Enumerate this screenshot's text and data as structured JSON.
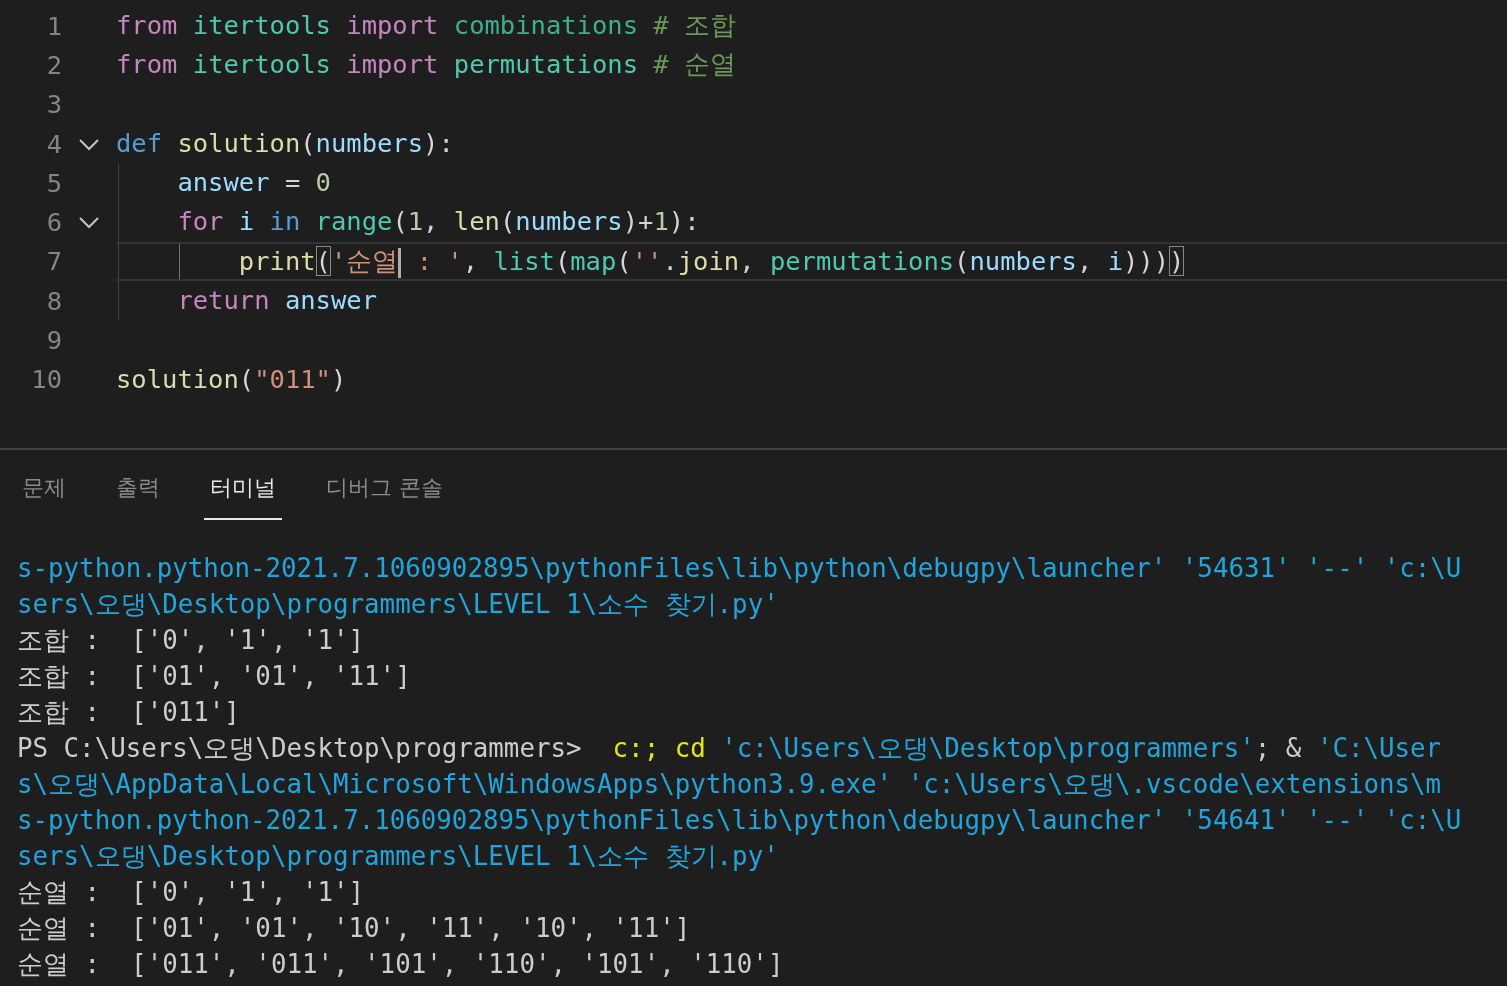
{
  "editor": {
    "lines": [
      {
        "number": "1",
        "current": false,
        "tokens": [
          {
            "text": "from",
            "kind": "keyword"
          },
          {
            "text": " itertools",
            "kind": "module"
          },
          {
            "text": " import",
            "kind": "keyword"
          },
          {
            "text": " combinations",
            "kind": "module_dim"
          },
          {
            "text": " # 조합",
            "kind": "comment"
          }
        ]
      },
      {
        "number": "2",
        "current": false,
        "tokens": [
          {
            "text": "from",
            "kind": "keyword"
          },
          {
            "text": " itertools",
            "kind": "module"
          },
          {
            "text": " import",
            "kind": "keyword"
          },
          {
            "text": " permutations",
            "kind": "module"
          },
          {
            "text": " # 순열",
            "kind": "comment"
          }
        ]
      },
      {
        "number": "3",
        "current": false
      },
      {
        "number": "4",
        "current": false,
        "expanded": true,
        "tokens": [
          {
            "text": "def",
            "kind": "storage"
          },
          {
            "text": " solution",
            "kind": "function"
          },
          {
            "text": "(",
            "kind": "plain"
          },
          {
            "text": "numbers",
            "kind": "variable"
          },
          {
            "text": "):",
            "kind": "plain"
          }
        ]
      },
      {
        "number": "5",
        "current": false,
        "tokens": [
          {
            "text": "    answer",
            "kind": "variable"
          },
          {
            "text": " = ",
            "kind": "plain"
          },
          {
            "text": "0",
            "kind": "number"
          }
        ]
      },
      {
        "number": "6",
        "current": false,
        "expanded": true,
        "tokens": [
          {
            "text": "    for",
            "kind": "keyword"
          },
          {
            "text": " i",
            "kind": "variable"
          },
          {
            "text": " in",
            "kind": "storage"
          },
          {
            "text": " range",
            "kind": "module"
          },
          {
            "text": "(",
            "kind": "plain"
          },
          {
            "text": "1",
            "kind": "number"
          },
          {
            "text": ", ",
            "kind": "plain"
          },
          {
            "text": "len",
            "kind": "function"
          },
          {
            "text": "(",
            "kind": "plain"
          },
          {
            "text": "numbers",
            "kind": "variable"
          },
          {
            "text": ")+",
            "kind": "plain"
          },
          {
            "text": "1",
            "kind": "number"
          },
          {
            "text": "):",
            "kind": "plain"
          }
        ]
      },
      {
        "number": "7",
        "current": true,
        "tokens": [
          {
            "text": "        print",
            "kind": "function"
          },
          {
            "text": "(",
            "kind": "plain",
            "matched": true
          },
          {
            "text": "'순열",
            "kind": "string",
            "cursor": true
          },
          {
            "text": " : '",
            "kind": "string"
          },
          {
            "text": ", ",
            "kind": "plain"
          },
          {
            "text": "list",
            "kind": "module"
          },
          {
            "text": "(",
            "kind": "plain"
          },
          {
            "text": "map",
            "kind": "module"
          },
          {
            "text": "(",
            "kind": "plain"
          },
          {
            "text": "''",
            "kind": "string"
          },
          {
            "text": ".",
            "kind": "plain"
          },
          {
            "text": "join",
            "kind": "function"
          },
          {
            "text": ", ",
            "kind": "plain"
          },
          {
            "text": "permutations",
            "kind": "module"
          },
          {
            "text": "(",
            "kind": "plain"
          },
          {
            "text": "numbers",
            "kind": "variable"
          },
          {
            "text": ", ",
            "kind": "plain"
          },
          {
            "text": "i",
            "kind": "variable"
          },
          {
            "text": ")))",
            "kind": "plain"
          },
          {
            "text": ")",
            "kind": "plain",
            "matched": true
          }
        ]
      },
      {
        "number": "8",
        "current": false,
        "tokens": [
          {
            "text": "    return",
            "kind": "keyword"
          },
          {
            "text": " answer",
            "kind": "variable"
          }
        ]
      },
      {
        "number": "9",
        "current": false
      },
      {
        "number": "10",
        "current": false,
        "tokens": [
          {
            "text": "solution",
            "kind": "function"
          },
          {
            "text": "(",
            "kind": "plain"
          },
          {
            "text": "\"011\"",
            "kind": "string"
          },
          {
            "text": ")",
            "kind": "plain"
          }
        ]
      }
    ]
  },
  "panel": {
    "tabs": [
      {
        "label": "문제",
        "selected": false
      },
      {
        "label": "출력",
        "selected": false
      },
      {
        "label": "터미널",
        "selected": true
      },
      {
        "label": "디버그 콘솔",
        "selected": false
      }
    ],
    "terminal_lines": [
      [
        {
          "text": "s-python.python-2021.7.1060902895\\pythonFiles\\lib\\python\\debugpy\\launcher' '54631' '--' 'c:\\U",
          "kind": "string"
        }
      ],
      [
        {
          "text": "sers\\오댕\\Desktop\\programmers\\LEVEL 1\\소수 찾기.py'",
          "kind": "string"
        }
      ],
      [
        {
          "text": "조합 :  ['0', '1', '1']",
          "kind": "output"
        }
      ],
      [
        {
          "text": "조합 :  ['01', '01', '11']",
          "kind": "output"
        }
      ],
      [
        {
          "text": "조합 :  ['011']",
          "kind": "output"
        }
      ],
      [
        {
          "text": "PS C:\\Users\\오댕\\Desktop\\programmers>  ",
          "kind": "output"
        },
        {
          "text": "c:;",
          "kind": "command"
        },
        {
          "text": " cd",
          "kind": "command"
        },
        {
          "text": " 'c:\\Users\\오댕\\Desktop\\programmers'",
          "kind": "string"
        },
        {
          "text": "; & ",
          "kind": "output"
        },
        {
          "text": "'C:\\User",
          "kind": "string"
        }
      ],
      [
        {
          "text": "s\\오댕\\AppData\\Local\\Microsoft\\WindowsApps\\python3.9.exe' 'c:\\Users\\오댕\\.vscode\\extensions\\m",
          "kind": "string"
        }
      ],
      [
        {
          "text": "s-python.python-2021.7.1060902895\\pythonFiles\\lib\\python\\debugpy\\launcher' '54641' '--' 'c:\\U",
          "kind": "string"
        }
      ],
      [
        {
          "text": "sers\\오댕\\Desktop\\programmers\\LEVEL 1\\소수 찾기.py'",
          "kind": "string"
        }
      ],
      [
        {
          "text": "순열 :  ['0', '1', '1']",
          "kind": "output"
        }
      ],
      [
        {
          "text": "순열 :  ['01', '01', '10', '11', '10', '11']",
          "kind": "output"
        }
      ],
      [
        {
          "text": "순열 :  ['011', '011', '101', '110', '101', '110']",
          "kind": "output"
        }
      ]
    ]
  }
}
